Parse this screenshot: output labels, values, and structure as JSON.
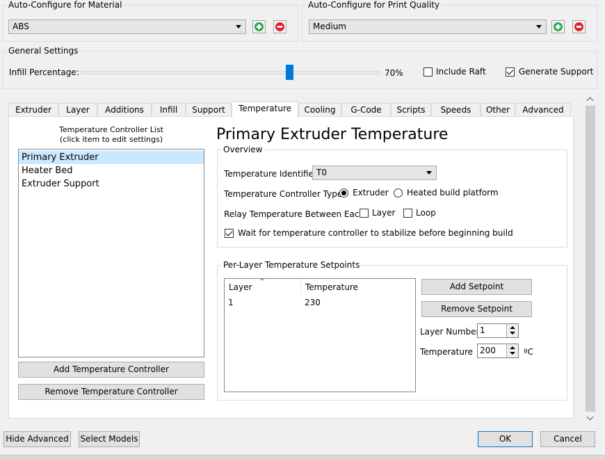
{
  "material": {
    "legend": "Auto-Configure for Material",
    "value": "ABS"
  },
  "quality": {
    "legend": "Auto-Configure for Print Quality",
    "value": "Medium"
  },
  "general": {
    "legend": "General Settings",
    "infill_label": "Infill Percentage:",
    "infill_value": "70%",
    "infill_fraction": 0.7,
    "include_raft_label": "Include Raft",
    "include_raft_checked": false,
    "generate_support_label": "Generate Support",
    "generate_support_checked": true
  },
  "tabs": [
    "Extruder",
    "Layer",
    "Additions",
    "Infill",
    "Support",
    "Temperature",
    "Cooling",
    "G-Code",
    "Scripts",
    "Speeds",
    "Other",
    "Advanced"
  ],
  "active_tab": "Temperature",
  "controller_list": {
    "title_line1": "Temperature Controller List",
    "title_line2": "(click item to edit settings)",
    "items": [
      "Primary Extruder",
      "Heater Bed",
      "Extruder Support"
    ],
    "selected": "Primary Extruder",
    "add_button": "Add Temperature Controller",
    "remove_button": "Remove Temperature Controller"
  },
  "detail": {
    "heading": "Primary Extruder Temperature",
    "overview": {
      "legend": "Overview",
      "identifier_label": "Temperature Identifier",
      "identifier_value": "T0",
      "type_label": "Temperature Controller Type:",
      "type_extruder": "Extruder",
      "type_heated": "Heated build platform",
      "type_selected": "Extruder",
      "relay_label": "Relay Temperature Between Each:",
      "relay_layer": "Layer",
      "relay_loop": "Loop",
      "wait_label": "Wait for temperature controller to stabilize before beginning build",
      "wait_checked": true
    },
    "setpoints": {
      "legend": "Per-Layer Temperature Setpoints",
      "col_layer": "Layer",
      "col_temp": "Temperature",
      "rows": [
        {
          "layer": "1",
          "temp": "230"
        }
      ],
      "add_button": "Add Setpoint",
      "remove_button": "Remove Setpoint",
      "layer_number_label": "Layer Number",
      "layer_number_value": "1",
      "temperature_label": "Temperature",
      "temperature_value": "200",
      "temperature_unit": "ºC"
    }
  },
  "footer": {
    "hide_advanced": "Hide Advanced",
    "select_models": "Select Models",
    "ok": "OK",
    "cancel": "Cancel"
  },
  "colors": {
    "accent": "#0078d7",
    "selection": "#cce8ff",
    "add_green": "#2fa84f",
    "remove_red": "#e0222b"
  }
}
